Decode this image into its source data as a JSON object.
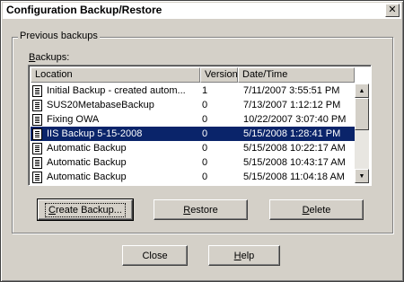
{
  "window": {
    "title": "Configuration Backup/Restore",
    "close_glyph": "✕"
  },
  "group": {
    "label": "Previous backups",
    "backups_label_accel": "B",
    "backups_label_rest": "ackups:"
  },
  "list": {
    "columns": [
      "Location",
      "Version",
      "Date/Time"
    ],
    "rows": [
      {
        "location": "Initial Backup - created autom...",
        "version": "1",
        "datetime": "7/11/2007 3:55:51 PM",
        "selected": false
      },
      {
        "location": "SUS20MetabaseBackup",
        "version": "0",
        "datetime": "7/13/2007 1:12:12 PM",
        "selected": false
      },
      {
        "location": "Fixing OWA",
        "version": "0",
        "datetime": "10/22/2007 3:07:40 PM",
        "selected": false
      },
      {
        "location": "IIS Backup 5-15-2008",
        "version": "0",
        "datetime": "5/15/2008 1:28:41 PM",
        "selected": true
      },
      {
        "location": "Automatic Backup",
        "version": "0",
        "datetime": "5/15/2008 10:22:17 AM",
        "selected": false
      },
      {
        "location": "Automatic Backup",
        "version": "0",
        "datetime": "5/15/2008 10:43:17 AM",
        "selected": false
      },
      {
        "location": "Automatic Backup",
        "version": "0",
        "datetime": "5/15/2008 11:04:18 AM",
        "selected": false
      }
    ],
    "scroll_up_glyph": "▲",
    "scroll_down_glyph": "▼"
  },
  "buttons": {
    "create_accel": "C",
    "create_rest": "reate Backup...",
    "restore_accel": "R",
    "restore_rest": "estore",
    "delete_accel": "D",
    "delete_rest": "elete",
    "close": "Close",
    "help_accel": "H",
    "help_rest": "elp"
  },
  "colors": {
    "dialog_bg": "#d4d0c8",
    "selection": "#0a246a"
  }
}
